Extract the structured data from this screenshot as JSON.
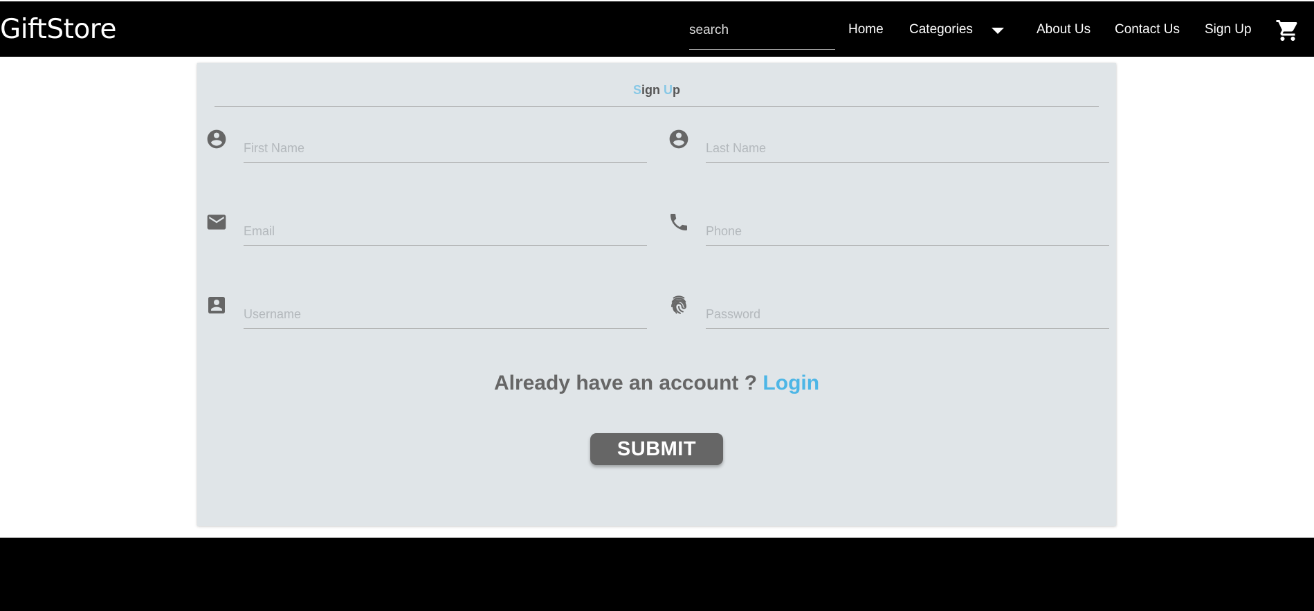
{
  "header": {
    "brand": "GiftStore",
    "search_placeholder": "search",
    "nav": {
      "home": "Home",
      "categories": "Categories",
      "about": "About Us",
      "contact": "Contact Us",
      "signup": "Sign Up"
    },
    "icons": {
      "categories_dropdown": "caret-down-icon",
      "cart": "shopping-cart-icon"
    }
  },
  "form": {
    "title": {
      "s_initial": "S",
      "s_rest": "ign ",
      "u_initial": "U",
      "u_rest": "p"
    },
    "fields": {
      "first_name": {
        "placeholder": "First Name",
        "value": "",
        "icon": "account-circle-icon"
      },
      "last_name": {
        "placeholder": "Last Name",
        "value": "",
        "icon": "account-circle-icon"
      },
      "email": {
        "placeholder": "Email",
        "value": "",
        "icon": "email-icon"
      },
      "phone": {
        "placeholder": "Phone",
        "value": "",
        "icon": "phone-icon"
      },
      "username": {
        "placeholder": "Username",
        "value": "",
        "icon": "account-box-icon"
      },
      "password": {
        "placeholder": "Password",
        "value": "",
        "icon": "fingerprint-icon"
      }
    },
    "login_prompt": "Already have an account ?",
    "login_link": "Login",
    "submit_label": "SUBMIT"
  },
  "colors": {
    "header_bg": "#000000",
    "card_bg": "#e0e5e8",
    "accent": "#4db6e6",
    "icon": "#666666",
    "button_bg": "#666666",
    "footer_bg": "#000000"
  }
}
